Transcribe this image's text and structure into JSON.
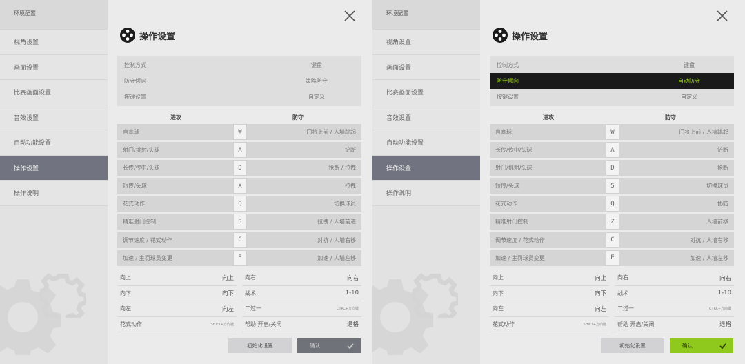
{
  "screens": [
    {
      "sidebar": {
        "header": "环境配置",
        "items": [
          {
            "label": "视角设置",
            "active": false
          },
          {
            "label": "画面设置",
            "active": false
          },
          {
            "label": "比赛画面设置",
            "active": false
          },
          {
            "label": "音效设置",
            "active": false
          },
          {
            "label": "自动功能设置",
            "active": false
          },
          {
            "label": "操作设置",
            "active": true
          },
          {
            "label": "操作说明",
            "active": false
          }
        ]
      },
      "title": "操作设置",
      "settings": [
        {
          "label": "控制方式",
          "value": "键盘",
          "highlighted": false
        },
        {
          "label": "防守倾向",
          "value": "策略防守",
          "highlighted": false
        },
        {
          "label": "按键设置",
          "value": "自定义",
          "highlighted": false
        }
      ],
      "columns": {
        "attack": "进攻",
        "defend": "防守"
      },
      "key_bindings": [
        {
          "attack": "直塞球",
          "key": "W",
          "defend": "门将上前 / 人墙跳起"
        },
        {
          "attack": "射门/挑射/头球",
          "key": "A",
          "defend": "铲断"
        },
        {
          "attack": "长传/传中/头球",
          "key": "D",
          "defend": "抢断 / 拉拽"
        },
        {
          "attack": "短传/头球",
          "key": "X",
          "defend": "拉拽"
        },
        {
          "attack": "花式动作",
          "key": "Q",
          "defend": "切换球员"
        },
        {
          "attack": "精准射门控制",
          "key": "S",
          "defend": "拉拽 / 人墙前进"
        },
        {
          "attack": "调节速度 / 花式动作",
          "key": "C",
          "defend": "对抗 / 人墙右移"
        },
        {
          "attack": "加速 / 主罚球员变更",
          "key": "E",
          "defend": "加速 / 人墙左移"
        }
      ],
      "directions_left": [
        {
          "label": "向上",
          "value": "向上"
        },
        {
          "label": "向下",
          "value": "向下"
        },
        {
          "label": "向左",
          "value": "向左"
        },
        {
          "label": "花式动作",
          "value": "SHIFT+方向键"
        }
      ],
      "directions_right": [
        {
          "label": "向右",
          "value": "向右"
        },
        {
          "label": "战术",
          "value": "1-10"
        },
        {
          "label": "二过一",
          "value": "CTRL+方向键"
        },
        {
          "label": "帮助 开启/关闭",
          "value": "退格"
        }
      ],
      "buttons": {
        "reset": "初始化设置",
        "confirm": "确认"
      }
    },
    {
      "sidebar": {
        "header": "环境配置",
        "items": [
          {
            "label": "视角设置",
            "active": false
          },
          {
            "label": "画面设置",
            "active": false
          },
          {
            "label": "比赛画面设置",
            "active": false
          },
          {
            "label": "音效设置",
            "active": false
          },
          {
            "label": "自动功能设置",
            "active": false
          },
          {
            "label": "操作设置",
            "active": true
          },
          {
            "label": "操作说明",
            "active": false
          }
        ]
      },
      "title": "操作设置",
      "settings": [
        {
          "label": "控制方式",
          "value": "键盘",
          "highlighted": false
        },
        {
          "label": "防守倾向",
          "value": "自动防守",
          "highlighted": true
        },
        {
          "label": "按键设置",
          "value": "自定义",
          "highlighted": false
        }
      ],
      "columns": {
        "attack": "进攻",
        "defend": "防守"
      },
      "key_bindings": [
        {
          "attack": "直塞球",
          "key": "W",
          "defend": "门将上前 / 人墙跳起"
        },
        {
          "attack": "长传/传中/头球",
          "key": "A",
          "defend": "铲断"
        },
        {
          "attack": "射门/挑射/头球",
          "key": "D",
          "defend": "抢断"
        },
        {
          "attack": "短传/头球",
          "key": "S",
          "defend": "切换球员"
        },
        {
          "attack": "花式动作",
          "key": "Q",
          "defend": "协防"
        },
        {
          "attack": "精准射门控制",
          "key": "Z",
          "defend": "人墙前移"
        },
        {
          "attack": "调节速度 / 花式动作",
          "key": "C",
          "defend": "对抗 / 人墙右移"
        },
        {
          "attack": "加速 / 主罚球员变更",
          "key": "E",
          "defend": "加速 / 人墙左移"
        }
      ],
      "directions_left": [
        {
          "label": "向上",
          "value": "向上"
        },
        {
          "label": "向下",
          "value": "向下"
        },
        {
          "label": "向左",
          "value": "向左"
        },
        {
          "label": "花式动作",
          "value": "SHIFT+方向键"
        }
      ],
      "directions_right": [
        {
          "label": "向右",
          "value": "向右"
        },
        {
          "label": "战术",
          "value": "1-10"
        },
        {
          "label": "二过一",
          "value": "CTRL+方向键"
        },
        {
          "label": "帮助 开启/关闭",
          "value": "退格"
        }
      ],
      "buttons": {
        "reset": "初始化设置",
        "confirm": "确认"
      },
      "confirm_style": "green"
    }
  ],
  "colors": {
    "active_sidebar": "#717480",
    "highlight_row_bg": "#1a1a1a",
    "highlight_row_text": "#9bd21c",
    "confirm_green": "#8fc91d",
    "confirm_gray": "#6f7278"
  },
  "icons": {
    "close": "close-x-icon",
    "title": "gamepad-dpad-icon",
    "confirm": "check-icon",
    "background": "gear-icon"
  }
}
